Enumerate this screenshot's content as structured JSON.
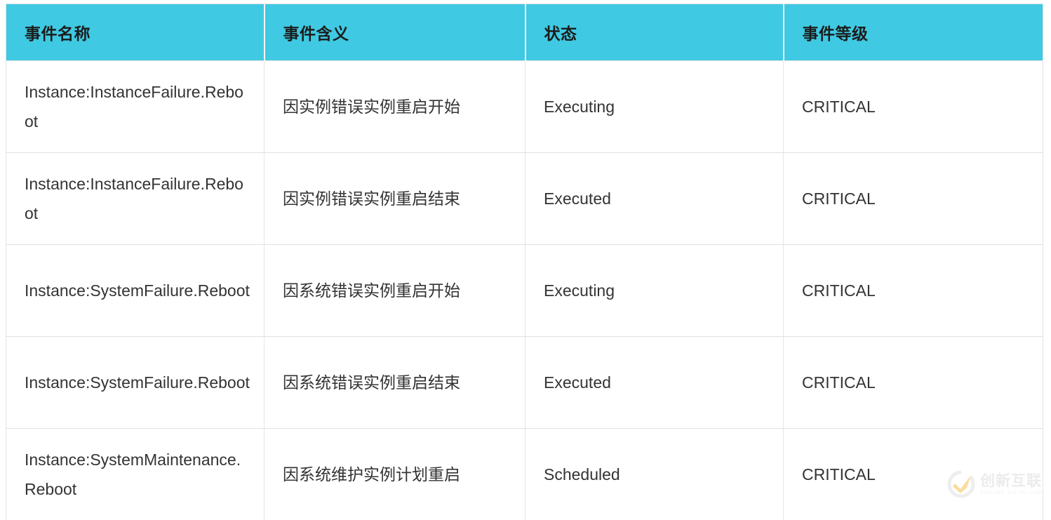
{
  "table": {
    "columns": [
      {
        "key": "name",
        "label": "事件名称"
      },
      {
        "key": "meaning",
        "label": "事件含义"
      },
      {
        "key": "status",
        "label": "状态"
      },
      {
        "key": "level",
        "label": "事件等级"
      }
    ],
    "rows": [
      {
        "name": "Instance:InstanceFailure.Reboot",
        "meaning": "因实例错误实例重启开始",
        "status": "Executing",
        "level": "CRITICAL"
      },
      {
        "name": "Instance:InstanceFailure.Reboot",
        "meaning": "因实例错误实例重启结束",
        "status": "Executed",
        "level": "CRITICAL"
      },
      {
        "name": "Instance:SystemFailure.Reboot",
        "meaning": "因系统错误实例重启开始",
        "status": "Executing",
        "level": "CRITICAL"
      },
      {
        "name": "Instance:SystemFailure.Reboot",
        "meaning": "因系统错误实例重启结束",
        "status": "Executed",
        "level": "CRITICAL"
      },
      {
        "name": "Instance:SystemMaintenance.Reboot",
        "meaning": "因系统维护实例计划重启",
        "status": "Scheduled",
        "level": "CRITICAL"
      }
    ]
  },
  "watermark": {
    "title": "创新互联",
    "subtitle": "CHUANG XIN HU LIAN",
    "mark_icon": "circle-check-logo-icon"
  },
  "colors": {
    "header_background": "#3fc9e2",
    "header_text": "#1c1c1c",
    "cell_text": "#333333",
    "row_border": "#e0e0e0",
    "column_border": "#e6e6e6",
    "watermark_accent": "#f5b731",
    "watermark_text": "#d8d8d8",
    "page_background": "#ffffff"
  }
}
